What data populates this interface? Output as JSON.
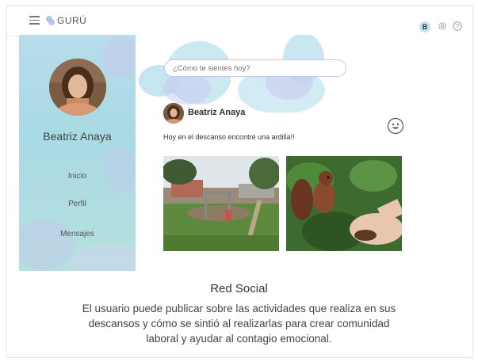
{
  "app": {
    "name": "GURÚ"
  },
  "header": {
    "user_initial": "B",
    "settings_icon": "gear-icon",
    "help_icon": "help-icon",
    "menu_icon": "hamburger-icon"
  },
  "sidebar": {
    "user_name": "Beatriz Anaya",
    "items": [
      {
        "label": "Inicio"
      },
      {
        "label": "Perfil"
      },
      {
        "label": "Mensajes"
      }
    ]
  },
  "composer": {
    "placeholder": "¿Cómo te sientes hoy?"
  },
  "post": {
    "author": "Beatriz Anaya",
    "text": "Hoy en el descanso encontré una ardilla!!",
    "reaction_icon": "smiley-icon",
    "images": [
      "park-photo",
      "squirrel-photo"
    ]
  },
  "caption": {
    "title": "Red Social",
    "text": "El usuario puede publicar sobre las actividades que realiza en sus descansos y cómo se sintió al realizarlas para crear comunidad laboral y ayudar al contagio emocional."
  },
  "colors": {
    "sidebar": "#b8ddea",
    "accent_blob": "#bfe3ef",
    "blob_purple": "#c9c6ee",
    "input_border": "#c9c4e8"
  }
}
